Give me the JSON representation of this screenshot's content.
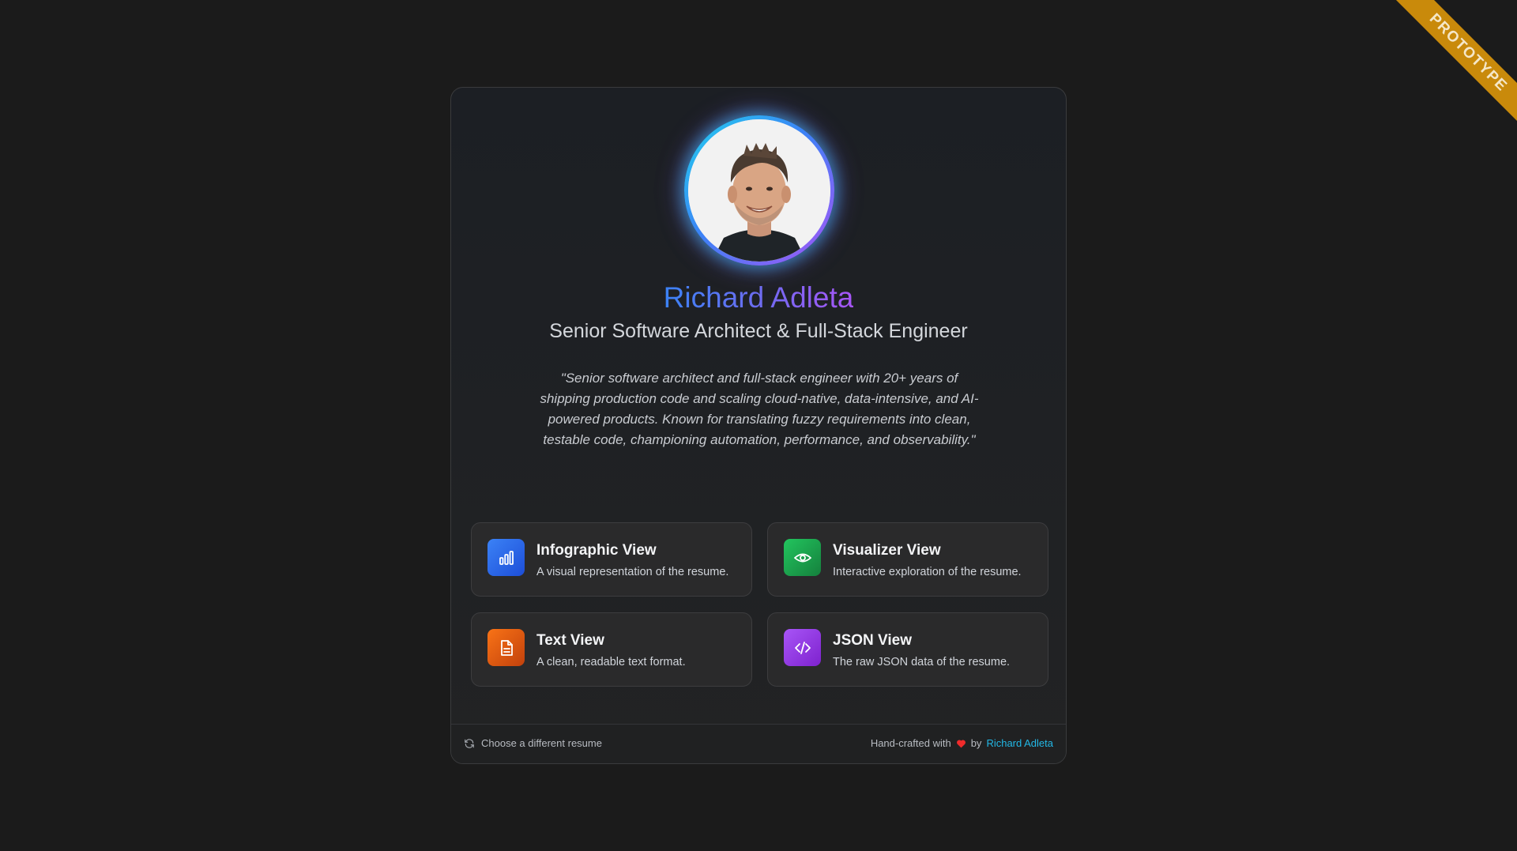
{
  "ribbon": {
    "label": "PROTOTYPE"
  },
  "profile": {
    "name": "Richard Adleta",
    "title": "Senior Software Architect & Full-Stack Engineer",
    "summary": "\"Senior software architect and full-stack engineer with 20+ years of shipping production code and scaling cloud-native, data-intensive, and AI-powered products. Known for translating fuzzy requirements into clean, testable code, championing automation, performance, and observability.\""
  },
  "views": [
    {
      "title": "Infographic View",
      "description": "A visual representation of the resume.",
      "icon": "bar-chart-icon",
      "color": "#2563eb"
    },
    {
      "title": "Visualizer View",
      "description": "Interactive exploration of the resume.",
      "icon": "eye-icon",
      "color": "#16a34a"
    },
    {
      "title": "Text View",
      "description": "A clean, readable text format.",
      "icon": "document-icon",
      "color": "#ea580c"
    },
    {
      "title": "JSON View",
      "description": "The raw JSON data of the resume.",
      "icon": "code-icon",
      "color": "#9333ea"
    }
  ],
  "footer": {
    "change_resume": "Choose a different resume",
    "credit_prefix": "Hand-crafted with",
    "credit_by": "by",
    "credit_author": "Richard Adleta"
  }
}
